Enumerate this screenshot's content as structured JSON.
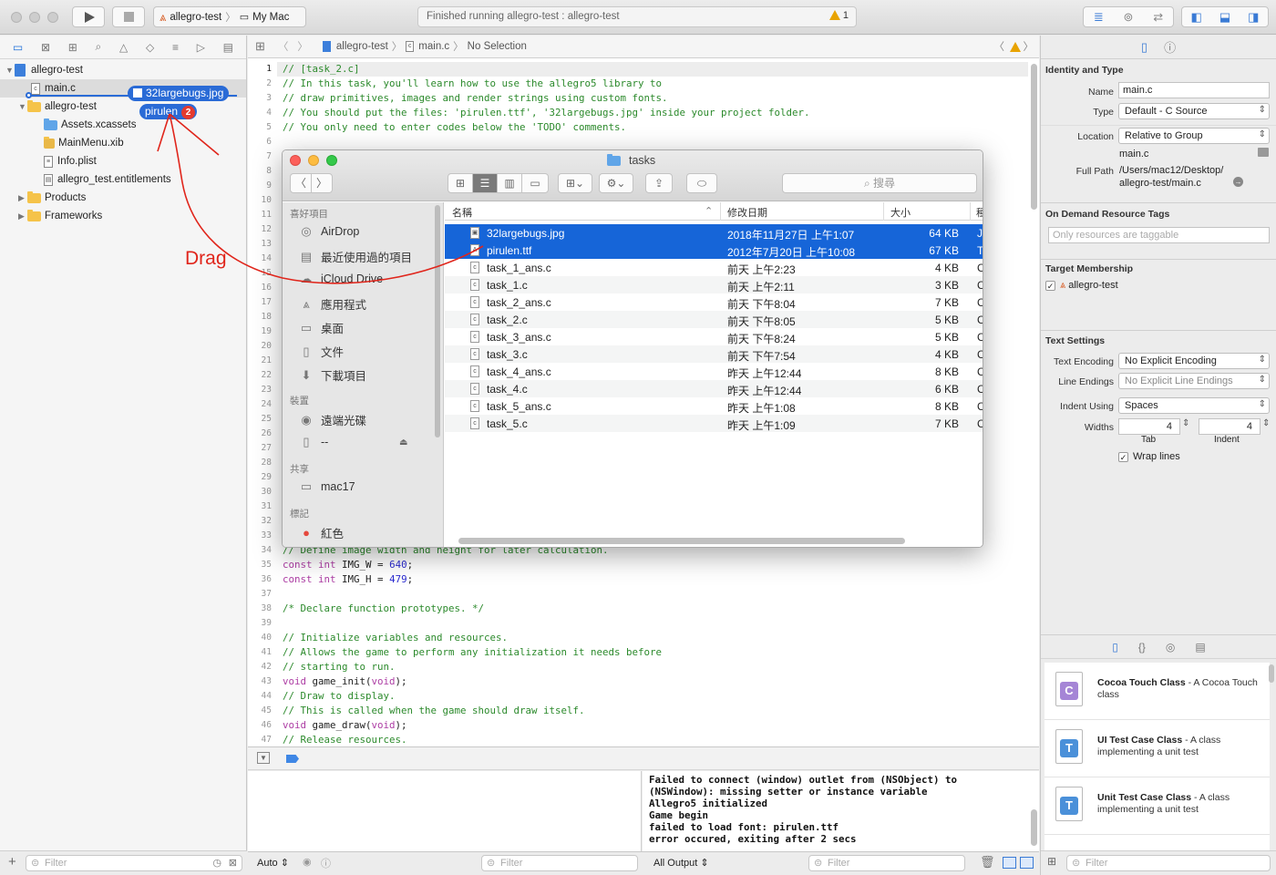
{
  "toolbar": {
    "scheme_name": "allegro-test",
    "destination": "My Mac",
    "activity_text": "Finished running allegro-test : allegro-test",
    "warning_count": "1"
  },
  "navigator": {
    "project": "allegro-test",
    "items": [
      {
        "label": "main.c",
        "kind": "file",
        "icon": "c-file-icon"
      },
      {
        "label": "allegro-test",
        "kind": "group",
        "icon": "folder-icon"
      },
      {
        "label": "Assets.xcassets",
        "kind": "asset",
        "icon": "asset-catalog-icon"
      },
      {
        "label": "MainMenu.xib",
        "kind": "file",
        "icon": "xib-file-icon"
      },
      {
        "label": "Info.plist",
        "kind": "file",
        "icon": "plist-file-icon"
      },
      {
        "label": "allegro_test.entitlements",
        "kind": "file",
        "icon": "entitlements-file-icon"
      },
      {
        "label": "Products",
        "kind": "group",
        "icon": "folder-icon"
      },
      {
        "label": "Frameworks",
        "kind": "group",
        "icon": "folder-icon"
      }
    ],
    "drag_items": [
      "32largebugs.jpg",
      "pirulen"
    ],
    "drag_count": "2",
    "filter_placeholder": "Filter"
  },
  "annotation": {
    "drag_label": "Drag",
    "color": "#e0251b"
  },
  "jumpbar": {
    "project": "allegro-test",
    "file": "main.c",
    "selection": "No Selection"
  },
  "editor": {
    "lines": [
      {
        "n": "1",
        "text": "// [task_2.c]",
        "cls": "c-com"
      },
      {
        "n": "2",
        "text": "// In this task, you'll learn how to use the allegro5 library to",
        "cls": "c-com"
      },
      {
        "n": "3",
        "text": "// draw primitives, images and render strings using custom fonts.",
        "cls": "c-com"
      },
      {
        "n": "4",
        "text": "// You should put the files: 'pirulen.ttf', '32largebugs.jpg' inside your project folder.",
        "cls": "c-com"
      },
      {
        "n": "5",
        "text": "// You only need to enter codes below the 'TODO' comments.",
        "cls": "c-com"
      },
      {
        "n": "6",
        "text": "",
        "cls": ""
      },
      {
        "n": "7",
        "text": "",
        "cls": ""
      },
      {
        "n": "8",
        "text": "",
        "cls": ""
      },
      {
        "n": "9",
        "text": "",
        "cls": ""
      },
      {
        "n": "10",
        "text": "",
        "cls": ""
      },
      {
        "n": "11",
        "text": "",
        "cls": ""
      },
      {
        "n": "12",
        "text": "",
        "cls": ""
      },
      {
        "n": "13",
        "text": "",
        "cls": ""
      },
      {
        "n": "14",
        "text": "",
        "cls": ""
      },
      {
        "n": "15",
        "text": "",
        "cls": ""
      },
      {
        "n": "16",
        "text": "",
        "cls": ""
      },
      {
        "n": "17",
        "text": "",
        "cls": ""
      },
      {
        "n": "18",
        "text": "",
        "cls": ""
      },
      {
        "n": "19",
        "text": "",
        "cls": ""
      },
      {
        "n": "20",
        "text": "",
        "cls": ""
      },
      {
        "n": "21",
        "text": "",
        "cls": ""
      },
      {
        "n": "22",
        "text": "",
        "cls": ""
      },
      {
        "n": "23",
        "text": "",
        "cls": ""
      },
      {
        "n": "24",
        "text": "",
        "cls": ""
      },
      {
        "n": "25",
        "text": "",
        "cls": ""
      },
      {
        "n": "26",
        "text": "",
        "cls": ""
      },
      {
        "n": "27",
        "text": "",
        "cls": ""
      },
      {
        "n": "28",
        "text": "",
        "cls": ""
      },
      {
        "n": "29",
        "text": "",
        "cls": ""
      },
      {
        "n": "30",
        "text": "",
        "cls": ""
      },
      {
        "n": "31",
        "text": "",
        "cls": ""
      },
      {
        "n": "32",
        "text": "",
        "cls": ""
      },
      {
        "n": "33",
        "text": "",
        "cls": ""
      },
      {
        "n": "34",
        "text": "// Define image width and height for later calculation.",
        "cls": "c-com"
      },
      {
        "n": "35",
        "text": "const int IMG_W = 640;",
        "cls": "decl"
      },
      {
        "n": "36",
        "text": "const int IMG_H = 479;",
        "cls": "decl"
      },
      {
        "n": "37",
        "text": "",
        "cls": ""
      },
      {
        "n": "38",
        "text": "/* Declare function prototypes. */",
        "cls": "c-com"
      },
      {
        "n": "39",
        "text": "",
        "cls": ""
      },
      {
        "n": "40",
        "text": "// Initialize variables and resources.",
        "cls": "c-com"
      },
      {
        "n": "41",
        "text": "// Allows the game to perform any initialization it needs before",
        "cls": "c-com"
      },
      {
        "n": "42",
        "text": "// starting to run.",
        "cls": "c-com"
      },
      {
        "n": "43",
        "text": "void game_init(void);",
        "cls": "fn"
      },
      {
        "n": "44",
        "text": "// Draw to display.",
        "cls": "c-com"
      },
      {
        "n": "45",
        "text": "// This is called when the game should draw itself.",
        "cls": "c-com"
      },
      {
        "n": "46",
        "text": "void game_draw(void);",
        "cls": "fn"
      },
      {
        "n": "47",
        "text": "// Release resources.",
        "cls": "c-com"
      }
    ]
  },
  "console": {
    "lines": [
      "Failed to connect (window) outlet from (NSObject) to",
      "(NSWindow): missing setter or instance variable",
      "Allegro5 initialized",
      "Game begin",
      "failed to load font: pirulen.ttf",
      "error occured, exiting after 2 secs"
    ],
    "output_select": "All Output",
    "filter_placeholder": "Filter"
  },
  "debug": {
    "auto_select": "Auto",
    "filter_placeholder": "Filter"
  },
  "inspector": {
    "identity_title": "Identity and Type",
    "name_label": "Name",
    "name_value": "main.c",
    "type_label": "Type",
    "type_value": "Default - C Source",
    "location_label": "Location",
    "location_value": "Relative to Group",
    "location_file": "main.c",
    "fullpath_label": "Full Path",
    "fullpath_line1": "/Users/mac12/Desktop/",
    "fullpath_line2": "allegro-test/main.c",
    "odr_title": "On Demand Resource Tags",
    "odr_placeholder": "Only resources are taggable",
    "target_title": "Target Membership",
    "target_name": "allegro-test",
    "text_title": "Text Settings",
    "encoding_label": "Text Encoding",
    "encoding_value": "No Explicit Encoding",
    "endings_label": "Line Endings",
    "endings_value": "No Explicit Line Endings",
    "indent_label": "Indent Using",
    "indent_value": "Spaces",
    "widths_label": "Widths",
    "tab_value": "4",
    "indent_width_value": "4",
    "tab_label": "Tab",
    "indent_sub_label": "Indent",
    "wrap_label": "Wrap lines",
    "library": [
      {
        "title": "Cocoa Touch Class",
        "desc": " - A Cocoa Touch class",
        "letter": "C",
        "color": "#a585d6"
      },
      {
        "title": "UI Test Case Class",
        "desc": " - A class implementing a unit test",
        "letter": "T",
        "color": "#4a90d9"
      },
      {
        "title": "Unit Test Case Class",
        "desc": " - A class implementing a unit test",
        "letter": "T",
        "color": "#4a90d9"
      }
    ],
    "filter_placeholder": "Filter"
  },
  "finder": {
    "title": "tasks",
    "search_placeholder": "搜尋",
    "sidebar": {
      "favorites_header": "喜好項目",
      "favorites": [
        {
          "label": "AirDrop",
          "icon": "airdrop-icon"
        },
        {
          "label": "最近使用過的項目",
          "icon": "recents-icon"
        },
        {
          "label": "iCloud Drive",
          "icon": "cloud-icon"
        },
        {
          "label": "應用程式",
          "icon": "applications-icon"
        },
        {
          "label": "桌面",
          "icon": "desktop-icon"
        },
        {
          "label": "文件",
          "icon": "documents-icon"
        },
        {
          "label": "下載項目",
          "icon": "downloads-icon"
        }
      ],
      "devices_header": "裝置",
      "devices": [
        {
          "label": "遠端光碟",
          "icon": "remote-disc-icon"
        },
        {
          "label": "--",
          "icon": "disk-icon"
        }
      ],
      "shared_header": "共享",
      "shared": [
        {
          "label": "mac17",
          "icon": "computer-icon"
        }
      ],
      "tags_header": "標記",
      "tags": [
        {
          "label": "紅色",
          "icon": "red-tag-icon",
          "color": "#e5483d"
        }
      ]
    },
    "columns": {
      "name": "名稱",
      "date": "修改日期",
      "size": "大小",
      "kind": "種"
    },
    "files": [
      {
        "name": "32largebugs.jpg",
        "date": "2018年11月27日 上午1:07",
        "size": "64 KB",
        "kind": "J",
        "selected": true,
        "icon": "image-file-icon"
      },
      {
        "name": "pirulen.ttf",
        "date": "2012年7月20日 上午10:08",
        "size": "67 KB",
        "kind": "T",
        "selected": true,
        "icon": "font-file-icon"
      },
      {
        "name": "task_1_ans.c",
        "date": "前天 上午2:23",
        "size": "4 KB",
        "kind": "C",
        "selected": false,
        "icon": "c-file-icon"
      },
      {
        "name": "task_1.c",
        "date": "前天 上午2:11",
        "size": "3 KB",
        "kind": "C",
        "selected": false,
        "icon": "c-file-icon"
      },
      {
        "name": "task_2_ans.c",
        "date": "前天 下午8:04",
        "size": "7 KB",
        "kind": "C",
        "selected": false,
        "icon": "c-file-icon"
      },
      {
        "name": "task_2.c",
        "date": "前天 下午8:05",
        "size": "5 KB",
        "kind": "C",
        "selected": false,
        "icon": "c-file-icon"
      },
      {
        "name": "task_3_ans.c",
        "date": "前天 下午8:24",
        "size": "5 KB",
        "kind": "C",
        "selected": false,
        "icon": "c-file-icon"
      },
      {
        "name": "task_3.c",
        "date": "前天 下午7:54",
        "size": "4 KB",
        "kind": "C",
        "selected": false,
        "icon": "c-file-icon"
      },
      {
        "name": "task_4_ans.c",
        "date": "昨天 上午12:44",
        "size": "8 KB",
        "kind": "C",
        "selected": false,
        "icon": "c-file-icon"
      },
      {
        "name": "task_4.c",
        "date": "昨天 上午12:44",
        "size": "6 KB",
        "kind": "C",
        "selected": false,
        "icon": "c-file-icon"
      },
      {
        "name": "task_5_ans.c",
        "date": "昨天 上午1:08",
        "size": "8 KB",
        "kind": "C",
        "selected": false,
        "icon": "c-file-icon"
      },
      {
        "name": "task_5.c",
        "date": "昨天 上午1:09",
        "size": "7 KB",
        "kind": "C",
        "selected": false,
        "icon": "c-file-icon"
      }
    ]
  }
}
